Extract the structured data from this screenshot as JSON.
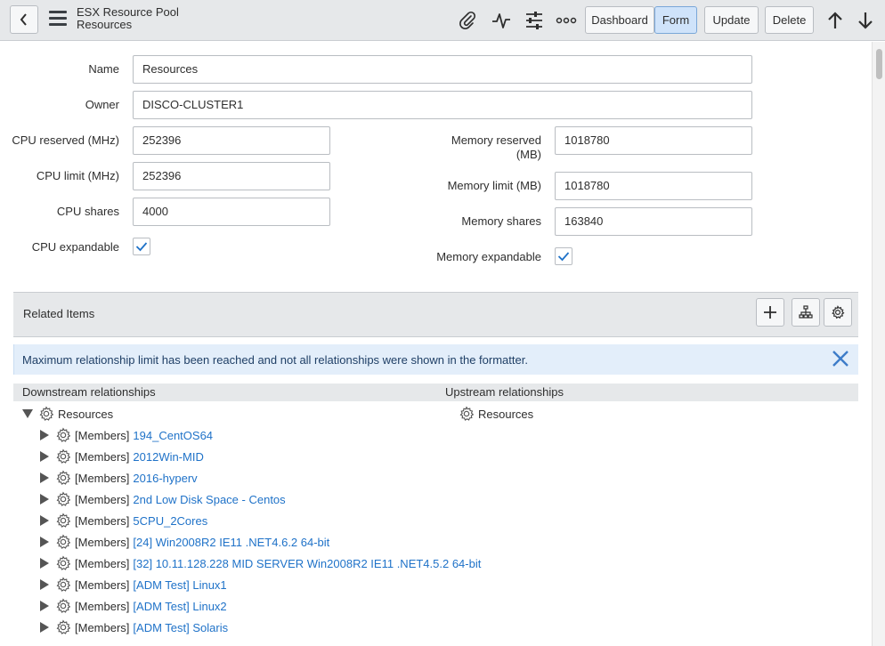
{
  "header": {
    "title_line1": "ESX Resource Pool",
    "title_line2": "Resources",
    "buttons": {
      "dashboard": "Dashboard",
      "form": "Form",
      "update": "Update",
      "delete": "Delete"
    }
  },
  "form": {
    "name": {
      "label": "Name",
      "value": "Resources"
    },
    "owner": {
      "label": "Owner",
      "value": "DISCO-CLUSTER1"
    },
    "cpu_reserved": {
      "label": "CPU reserved (MHz)",
      "value": "252396"
    },
    "cpu_limit": {
      "label": "CPU limit (MHz)",
      "value": "252396"
    },
    "cpu_shares": {
      "label": "CPU shares",
      "value": "4000"
    },
    "cpu_expandable": {
      "label": "CPU expandable",
      "checked": true
    },
    "memory_reserved": {
      "label_line1": "Memory reserved",
      "label_line2": "(MB)",
      "value": "1018780"
    },
    "memory_limit": {
      "label": "Memory limit (MB)",
      "value": "1018780"
    },
    "memory_shares": {
      "label": "Memory shares",
      "value": "163840"
    },
    "memory_expandable": {
      "label": "Memory expandable",
      "checked": true
    }
  },
  "related": {
    "title": "Related Items",
    "alert": "Maximum relationship limit has been reached and not all relationships were shown in the formatter.",
    "downstream_header": "Downstream relationships",
    "upstream_header": "Upstream relationships",
    "root": "Resources",
    "upstream_root": "Resources",
    "member_prefix": "[Members]",
    "members": [
      "194_CentOS64",
      "2012Win-MID",
      "2016-hyperv",
      "2nd Low Disk Space - Centos",
      "5CPU_2Cores",
      "[24] Win2008R2 IE11 .NET4.6.2 64-bit",
      "[32] 10.11.128.228 MID SERVER Win2008R2 IE11 .NET4.5.2 64-bit",
      "[ADM Test] Linux1",
      "[ADM Test] Linux2",
      "[ADM Test] Solaris"
    ]
  },
  "icons": {
    "back": "chevron-left-icon",
    "menu": "hamburger-menu-icon",
    "attachment": "paperclip-icon",
    "activity": "activity-pulse-icon",
    "personalize": "sliders-icon",
    "more": "more-options-icon",
    "up": "arrow-up-icon",
    "down": "arrow-down-icon"
  },
  "colors": {
    "link": "#1f72c8",
    "active_button": "#cfe3fa",
    "check": "#1f72c8"
  }
}
